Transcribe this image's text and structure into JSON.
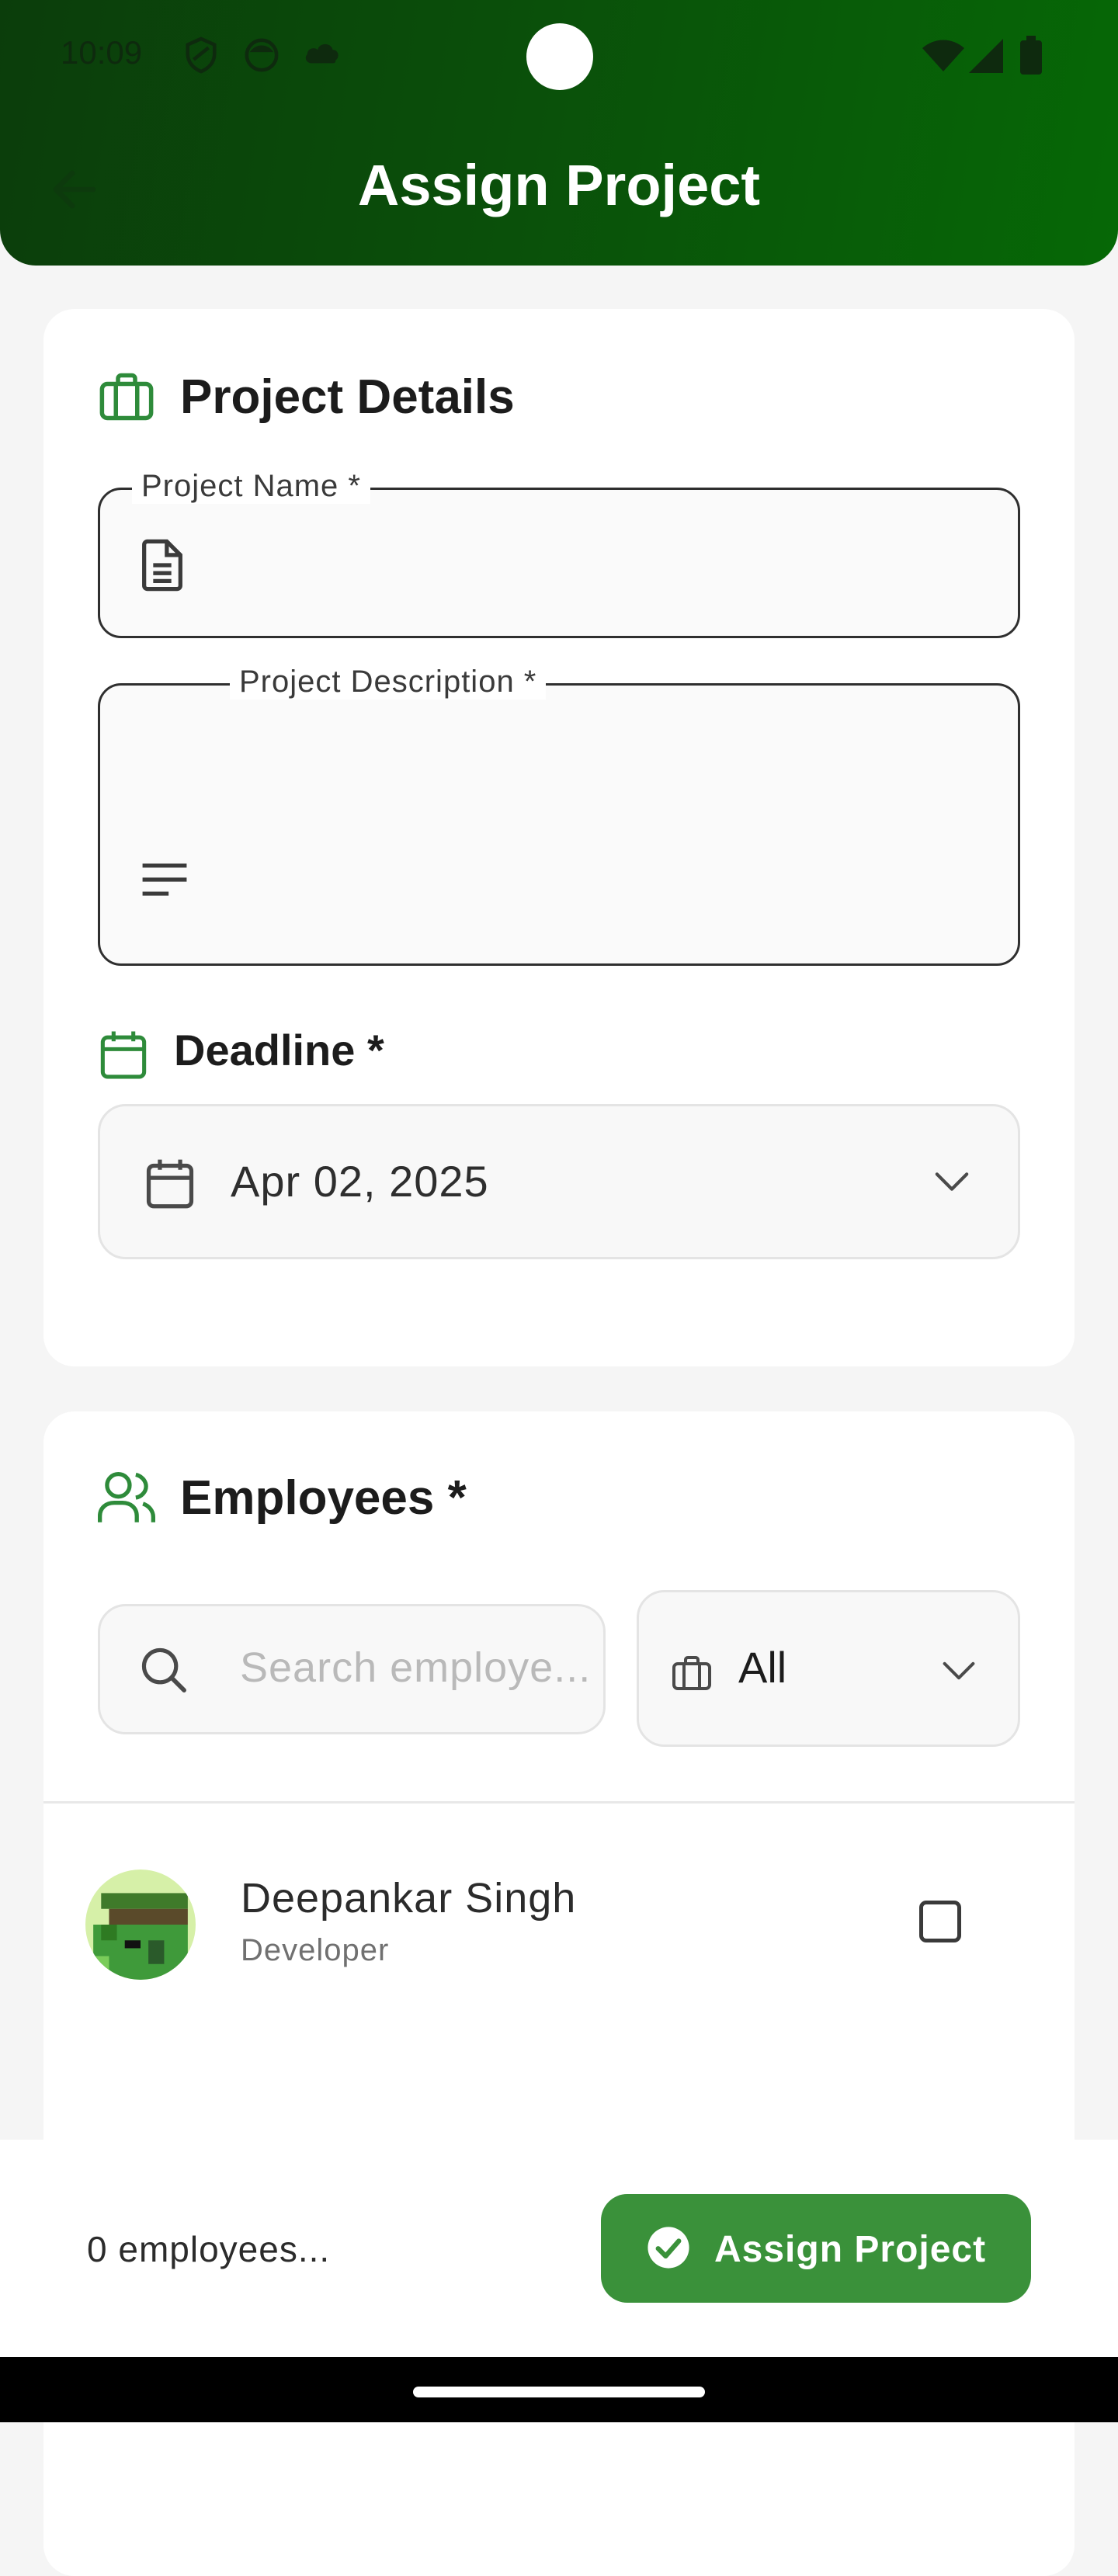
{
  "status_bar": {
    "time": "10:09"
  },
  "header": {
    "title": "Assign Project"
  },
  "project_details": {
    "title": "Project Details",
    "name_label": "Project Name *",
    "name_value": "",
    "description_label": "Project Description *",
    "description_value": "",
    "deadline_title": "Deadline *",
    "deadline_value": "Apr 02, 2025"
  },
  "employees": {
    "title": "Employees *",
    "search_placeholder": "Search employe...",
    "filter_value": "All",
    "list": [
      {
        "name": "Deepankar Singh",
        "role": "Developer",
        "selected": false
      }
    ]
  },
  "footer": {
    "selected_count_text": "0 employees...",
    "assign_label": "Assign Project"
  },
  "colors": {
    "accent": "#3a913a",
    "header_start": "#0b3d0b",
    "header_end": "#066806",
    "icon_green": "#2e8b3a"
  }
}
